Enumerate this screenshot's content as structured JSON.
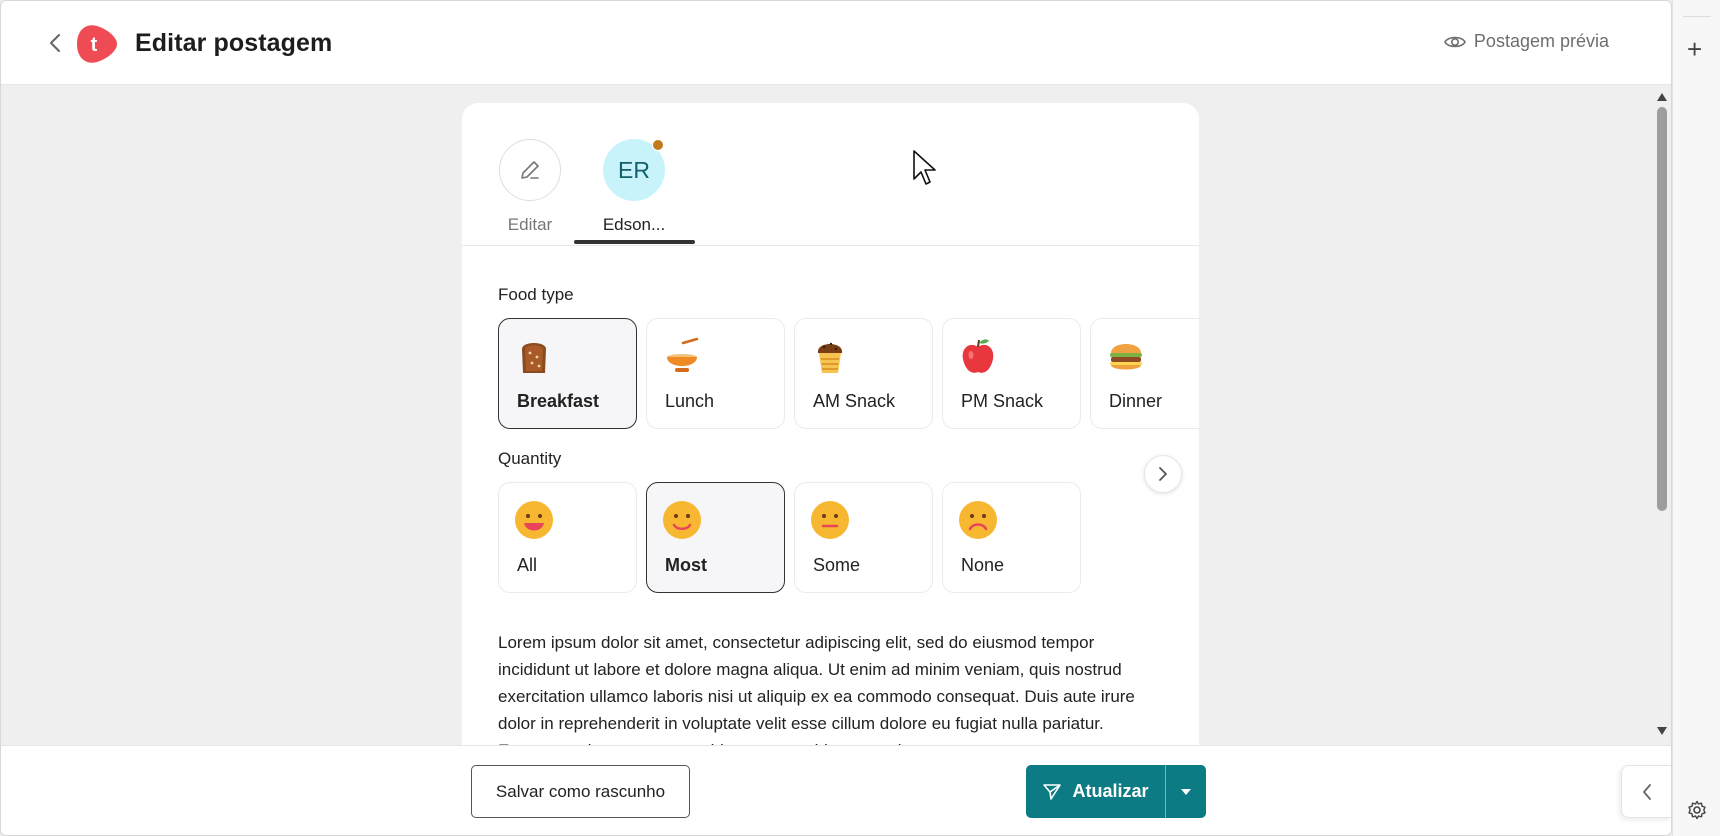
{
  "header": {
    "title": "Editar postagem",
    "logo_letter": "t",
    "preview_label": "Postagem prévia"
  },
  "tabs": [
    {
      "label": "Editar"
    },
    {
      "label": "Edson...",
      "initials": "ER"
    }
  ],
  "food_type": {
    "title": "Food type",
    "options": [
      {
        "label": "Breakfast",
        "icon": "bread-icon",
        "selected": true
      },
      {
        "label": "Lunch",
        "icon": "bowl-icon",
        "selected": false
      },
      {
        "label": "AM Snack",
        "icon": "muffin-icon",
        "selected": false
      },
      {
        "label": "PM Snack",
        "icon": "apple-icon",
        "selected": false
      },
      {
        "label": "Dinner",
        "icon": "burger-icon",
        "selected": false
      }
    ]
  },
  "quantity": {
    "title": "Quantity",
    "options": [
      {
        "label": "All",
        "icon": "grinning-face-icon",
        "selected": false
      },
      {
        "label": "Most",
        "icon": "smiling-face-icon",
        "selected": true
      },
      {
        "label": "Some",
        "icon": "neutral-face-icon",
        "selected": false
      },
      {
        "label": "None",
        "icon": "frowning-face-icon",
        "selected": false
      }
    ]
  },
  "body_text": "Lorem ipsum dolor sit amet, consectetur adipiscing elit, sed do eiusmod tempor incididunt ut labore et dolore magna aliqua. Ut enim ad minim veniam, quis nostrud exercitation ullamco laboris nisi ut aliquip ex ea commodo consequat. Duis aute irure dolor in reprehenderit in voluptate velit esse cillum dolore eu fugiat nulla pariatur. Excepteur sint occaecat cupidatat non proident, sunt in",
  "footer": {
    "draft_label": "Salvar como rascunho",
    "update_label": "Atualizar"
  },
  "colors": {
    "brand": "#ef4b55",
    "primary": "#0c7b83",
    "avatar_bg": "#c9f3fb",
    "status_dot": "#c27a1e"
  }
}
